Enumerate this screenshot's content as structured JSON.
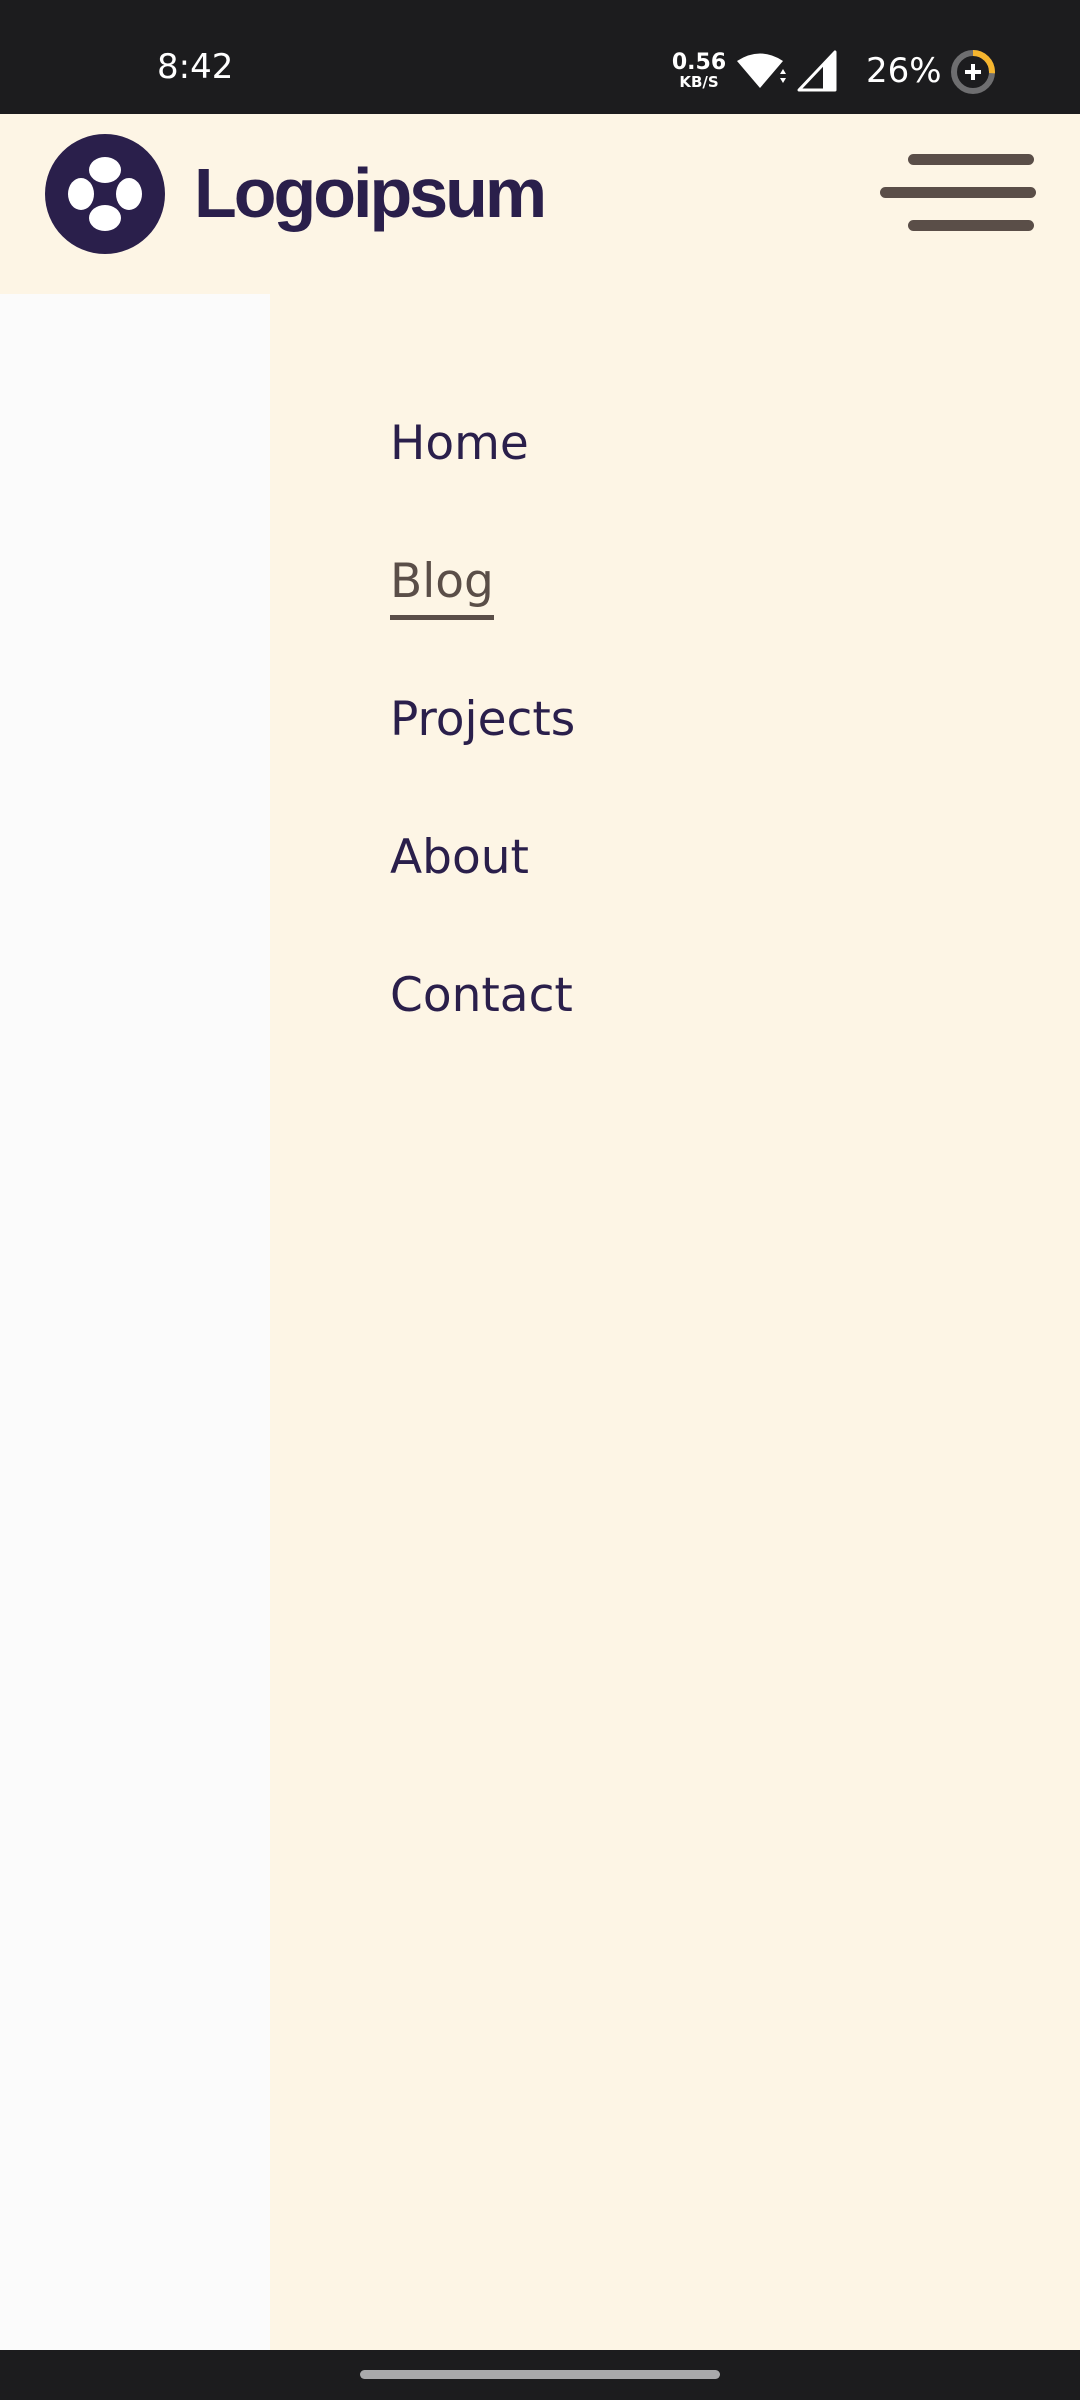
{
  "status_bar": {
    "time": "8:42",
    "net_speed_value": "0.56",
    "net_speed_unit": "KB/S",
    "battery_percent": "26%",
    "battery_level": 0.26,
    "icons": [
      "wifi-icon",
      "signal-icon",
      "battery-saver-icon"
    ]
  },
  "header": {
    "logo_text": "Logoipsum",
    "logo_icon": "logo-icon",
    "menu_icon": "hamburger-menu-icon"
  },
  "nav": {
    "items": [
      {
        "label": "Home",
        "active": false
      },
      {
        "label": "Blog",
        "active": true
      },
      {
        "label": "Projects",
        "active": false
      },
      {
        "label": "About",
        "active": false
      },
      {
        "label": "Contact",
        "active": false
      }
    ]
  },
  "colors": {
    "status_bar_bg": "#1C1C1E",
    "header_bg": "#FDF5E5",
    "brand": "#2A1F4B",
    "accent": "#5A4E48",
    "battery_ring": "#F5B52E",
    "left_panel_bg": "#FBFBFB"
  }
}
